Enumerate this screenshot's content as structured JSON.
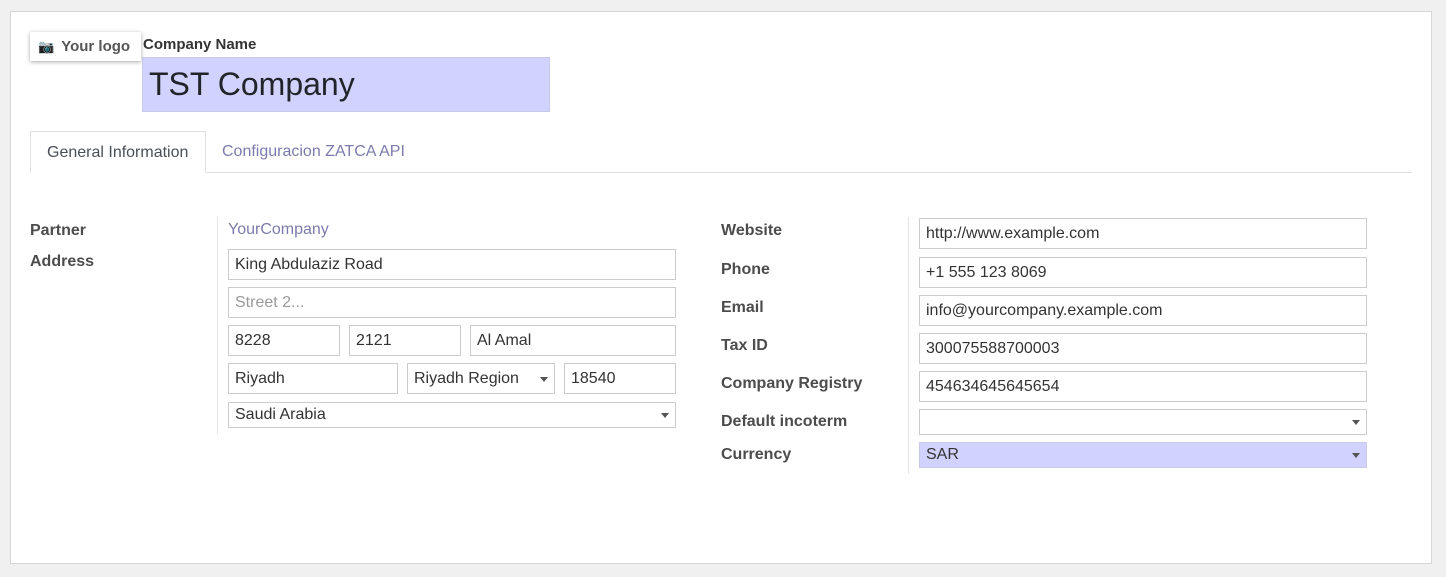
{
  "header": {
    "logo_label": "Your logo",
    "company_name_label": "Company Name",
    "company_name_value": "TST Company"
  },
  "tabs": [
    {
      "label": "General Information",
      "active": true
    },
    {
      "label": "Configuracion ZATCA API",
      "active": false
    }
  ],
  "left": {
    "partner_label": "Partner",
    "partner_value": "YourCompany",
    "address_label": "Address",
    "street": "King Abdulaziz Road",
    "street2_placeholder": "Street 2...",
    "building_no": "8228",
    "additional_no": "2121",
    "district": "Al Amal",
    "city": "Riyadh",
    "state": "Riyadh Region",
    "zip": "18540",
    "country": "Saudi Arabia"
  },
  "right": {
    "website_label": "Website",
    "website_value": "http://www.example.com",
    "phone_label": "Phone",
    "phone_value": "+1 555 123 8069",
    "email_label": "Email",
    "email_value": "info@yourcompany.example.com",
    "taxid_label": "Tax ID",
    "taxid_value": "300075588700003",
    "registry_label": "Company Registry",
    "registry_value": "454634645645654",
    "incoterm_label": "Default incoterm",
    "incoterm_value": "",
    "currency_label": "Currency",
    "currency_value": "SAR"
  },
  "icons": {
    "logo_icon": "camera-icon",
    "dropdown_icon": "caret-down-icon"
  },
  "colors": {
    "highlight": "#d2d2ff",
    "link": "#7c7bad"
  }
}
